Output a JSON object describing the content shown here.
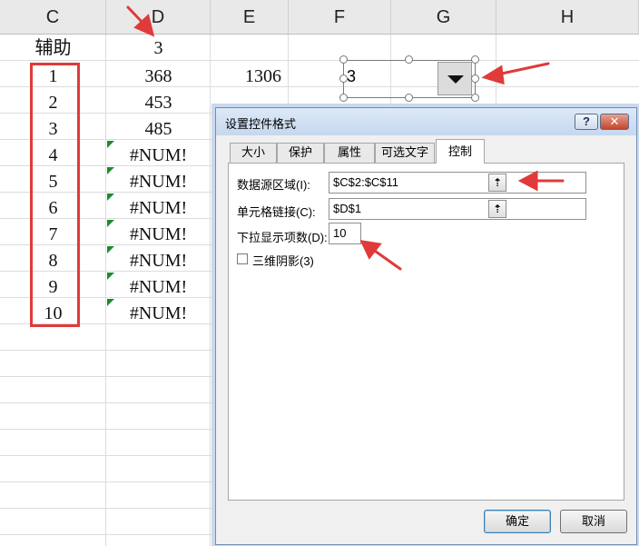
{
  "sheet": {
    "columns": [
      "C",
      "D",
      "E",
      "F",
      "G",
      "H"
    ],
    "helper_label": "辅助",
    "d1_value": "3",
    "e2_value": "1306",
    "c_values": [
      "1",
      "2",
      "3",
      "4",
      "5",
      "6",
      "7",
      "8",
      "9",
      "10"
    ],
    "d_values": [
      "368",
      "453",
      "485",
      "#NUM!",
      "#NUM!",
      "#NUM!",
      "#NUM!",
      "#NUM!",
      "#NUM!",
      "#NUM!"
    ]
  },
  "combo": {
    "value": "3"
  },
  "dialog": {
    "title": "设置控件格式",
    "help_label": "?",
    "close_label": "✕",
    "tabs": [
      "大小",
      "保护",
      "属性",
      "可选文字",
      "控制"
    ],
    "active_tab": "控制",
    "input_range_label": "数据源区域(I):",
    "input_range_value": "$C$2:$C$11",
    "cell_link_label": "单元格链接(C):",
    "cell_link_value": "$D$1",
    "dropdown_lines_label": "下拉显示项数(D):",
    "dropdown_lines_value": "10",
    "shading_label": "三维阴影(3)",
    "ok_label": "确定",
    "cancel_label": "取消"
  },
  "colors": {
    "annotation_red": "#e03a3a",
    "error_flag_green": "#1e8a2e"
  },
  "icons": {
    "combo_arrow": "triangle-down-icon",
    "ref_button": "collapse-dialog-icon"
  }
}
